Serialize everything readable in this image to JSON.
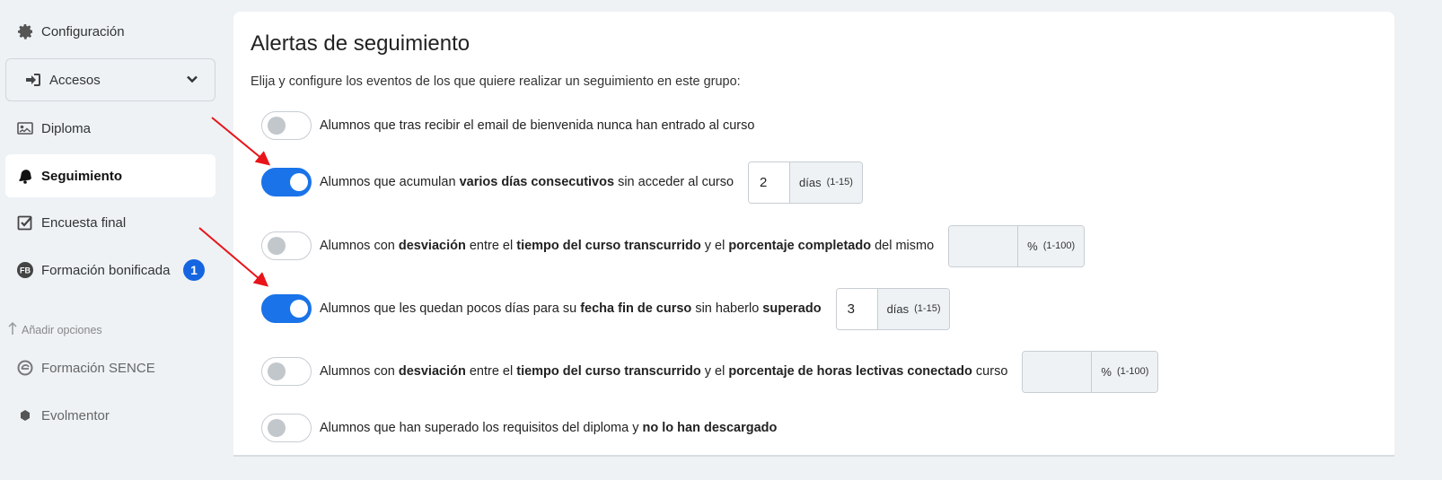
{
  "sidebar": {
    "items": [
      {
        "label": "Configuración",
        "icon": "gear-icon"
      },
      {
        "label": "Accesos",
        "icon": "sign-in-icon"
      },
      {
        "label": "Diploma",
        "icon": "diploma-icon"
      },
      {
        "label": "Seguimiento",
        "icon": "bell-icon"
      },
      {
        "label": "Encuesta final",
        "icon": "checkbox-icon"
      },
      {
        "label": "Formación bonificada",
        "icon": "fb-icon",
        "badge": "1"
      },
      {
        "label": "Formación SENCE",
        "icon": "sence-icon"
      },
      {
        "label": "Evolmentor",
        "icon": "evolmentor-icon"
      }
    ],
    "section_label": "Añadir opciones"
  },
  "main": {
    "title": "Alertas de seguimiento",
    "subtitle": "Elija y configure los eventos de los que quiere realizar un seguimiento en este grupo:",
    "alerts": [
      {
        "enabled": false,
        "parts": [
          "Alumnos que tras recibir el email de bienvenida nunca han entrado al curso"
        ]
      },
      {
        "enabled": true,
        "parts": [
          "Alumnos que acumulan ",
          "varios días consecutivos",
          " sin acceder al curso"
        ],
        "input": {
          "value": "2",
          "unit": "días",
          "range": "(1-15)"
        }
      },
      {
        "enabled": false,
        "parts": [
          "Alumnos con ",
          "desviación",
          " entre el ",
          "tiempo del curso transcurrido",
          " y el ",
          "porcentaje completado",
          " del mismo"
        ],
        "input": {
          "value": "",
          "unit": "%",
          "range": "(1-100)"
        }
      },
      {
        "enabled": true,
        "parts": [
          "Alumnos que les quedan pocos días para su ",
          "fecha fin de curso",
          " sin haberlo ",
          "superado"
        ],
        "input": {
          "value": "3",
          "unit": "días",
          "range": "(1-15)"
        }
      },
      {
        "enabled": false,
        "parts": [
          "Alumnos con ",
          "desviación",
          " entre el ",
          "tiempo del curso transcurrido",
          " y el ",
          "porcentaje de horas lectivas conectado",
          " curso"
        ],
        "input": {
          "value": "",
          "unit": "%",
          "range": "(1-100)"
        }
      },
      {
        "enabled": false,
        "parts": [
          "Alumnos que han superado los requisitos del diploma y ",
          "no lo han descargado"
        ]
      }
    ]
  },
  "colors": {
    "accent": "#1a73e8",
    "badge": "#1565e0",
    "annotation_arrow": "#e8141a"
  }
}
